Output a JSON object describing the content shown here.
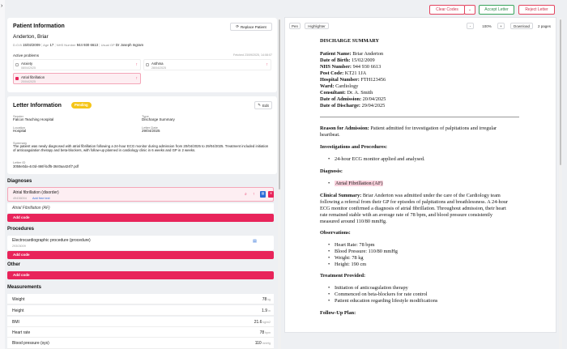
{
  "toolbar": {
    "clear_codes": "Clear Codes",
    "accept_letter": "Accept Letter",
    "reject_letter": "Reject Letter"
  },
  "patient": {
    "section_title": "Patient Information",
    "replace_button": "Replace Patient",
    "name": "Anderton, Briar",
    "dob_label": "D.O.B",
    "dob": "15/02/2009",
    "age_label": "Age",
    "age": "17",
    "nhs_label": "NHS Number",
    "nhs": "944 930 6613",
    "gp_label": "Usual GP",
    "gp": "Dr Joseph Ingram",
    "problems_title": "Active problems",
    "fetched": "Fetched 23/09/2025, 14:08:07",
    "problems": [
      {
        "name": "Anxiety",
        "date": "08/04/2025"
      },
      {
        "name": "Asthma",
        "date": "28/04/2025"
      },
      {
        "name": "Atrial fibrillation",
        "date": "20/04/2025"
      }
    ]
  },
  "letter": {
    "section_title": "Letter Information",
    "status": "Pending",
    "edit": "Edit",
    "sender_label": "Sender",
    "sender": "Falcon Teaching Hospital",
    "type_label": "Type",
    "type": "Discharge Summary",
    "location_label": "Location",
    "location": "Hospital",
    "date_label": "Letter Date",
    "date": "29/04/2025",
    "summary_label": "Summary",
    "summary": "The patient was newly diagnosed with atrial fibrillation following a 24-hour ECG monitor during admission from 20/04/2025 to 29/04/2025. Treatment included initiation of anticoagulation therapy and beta-blockers, with follow-up planned in cardiology clinic in 6 weeks and GP in 2 weeks.",
    "id_label": "Letter ID",
    "id": "3058e0da-4c0d-466f-bdf5-3640aa424f7.pdf"
  },
  "diagnoses": {
    "title": "Diagnoses",
    "item": "Atrial fibrillation (disorder)",
    "code": "49436004",
    "add_free_text": "Add free text",
    "subitem": "Atrial Fibrillation (AF)",
    "add_code": "Add code"
  },
  "procedures": {
    "title": "Procedures",
    "item": "Electrocardiographic procedure (procedure)",
    "code": "29303009",
    "add_code": "Add code"
  },
  "other": {
    "title": "Other",
    "add_code": "Add code"
  },
  "measurements": {
    "title": "Measurements",
    "rows": [
      {
        "name": "Weight",
        "value": "78",
        "unit": "kg"
      },
      {
        "name": "Height",
        "value": "1.9",
        "unit": "m"
      },
      {
        "name": "BMI",
        "value": "21.6",
        "unit": "kg/m2"
      },
      {
        "name": "Heart rate",
        "value": "78",
        "unit": "bpm"
      },
      {
        "name": "Blood pressure (sys)",
        "value": "110",
        "unit": "mmHg"
      }
    ]
  },
  "viewer": {
    "pen": "Pen",
    "highlighter": "Highlighter",
    "minus": "-",
    "zoom": "100%",
    "plus": "+",
    "download": "Download",
    "pages": "2 pages"
  },
  "document": {
    "title": "DISCHARGE SUMMARY",
    "fields": [
      {
        "label": "Patient Name:",
        "value": "Briar Anderton"
      },
      {
        "label": "Date of Birth:",
        "value": "15/02/2009"
      },
      {
        "label": "NHS Number:",
        "value": "944 930 6613"
      },
      {
        "label": "Post Code:",
        "value": "KT21 1JA"
      },
      {
        "label": "Hospital Number:",
        "value": "FTH123456"
      },
      {
        "label": "Ward:",
        "value": "Cardiology"
      },
      {
        "label": "Consultant:",
        "value": "Dr. A. Smith"
      },
      {
        "label": "Date of Admission:",
        "value": "20/04/2025"
      },
      {
        "label": "Date of Discharge:",
        "value": "29/04/2025"
      }
    ],
    "reason_label": "Reason for Admission:",
    "reason_l1": "Patient admitted for investigation of palpitations and irregular",
    "reason_l2": "heartbeat.",
    "inv_title": "Investigations and Procedures:",
    "inv_item": "24-hour ECG monitor applied and analysed.",
    "diag_title": "Diagnosis:",
    "diag_item": "Atrial Fibrillation (AF)",
    "clin_label": "Clinical Summary:",
    "clin_l1": "Briar Anderton was admitted under the care of the Cardiology team",
    "clin_l2": "following a referral from their GP for episodes of palpitations and breathlessness. A 24-hour",
    "clin_l3": "ECG monitor confirmed a diagnosis of atrial fibrillation. Throughout admission, their heart",
    "clin_l4": "rate remained stable with an average rate of 78 bpm, and blood pressure consistently",
    "clin_l5": "measured around 110/80 mmHg.",
    "obs_title": "Observations:",
    "obs_items": [
      "Heart Rate: 78 bpm",
      "Blood Pressure: 110/80 mmHg",
      "Weight: 78 kg",
      "Height: 190 cm"
    ],
    "treat_title": "Treatment Provided:",
    "treat_items": [
      "Initiation of anticoagulation therapy",
      "Commenced on beta-blockers for rate control",
      "Patient education regarding lifestyle modifications"
    ],
    "follow_title": "Follow-Up Plan:"
  },
  "colors": {
    "accent": "#e8245a",
    "pending": "#f5c518",
    "green": "#3aa35b"
  }
}
